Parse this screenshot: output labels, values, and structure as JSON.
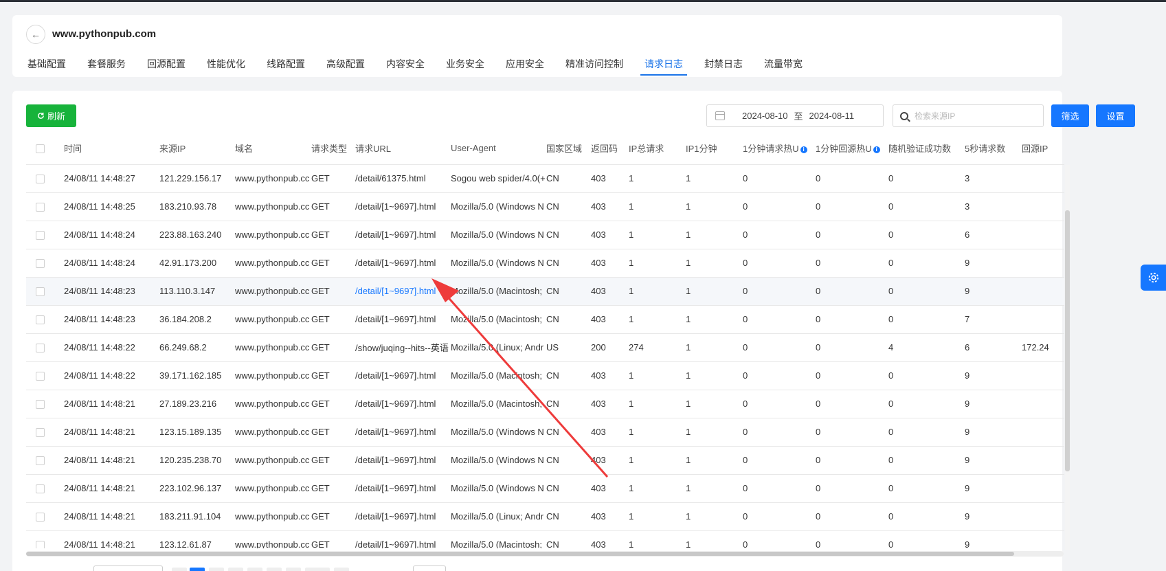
{
  "site": {
    "title": "www.pythonpub.com"
  },
  "tabs": [
    {
      "label": "基础配置"
    },
    {
      "label": "套餐服务"
    },
    {
      "label": "回源配置"
    },
    {
      "label": "性能优化"
    },
    {
      "label": "线路配置"
    },
    {
      "label": "高级配置"
    },
    {
      "label": "内容安全"
    },
    {
      "label": "业务安全"
    },
    {
      "label": "应用安全"
    },
    {
      "label": "精准访问控制"
    },
    {
      "label": "请求日志"
    },
    {
      "label": "封禁日志"
    },
    {
      "label": "流量带宽"
    }
  ],
  "active_tab": "请求日志",
  "toolbar": {
    "refresh_label": "刷新",
    "date_start": "2024-08-10",
    "date_sep": "至",
    "date_end": "2024-08-11",
    "search_placeholder": "检索来源IP",
    "filter_label": "筛选",
    "settings_label": "设置"
  },
  "table": {
    "headers": {
      "time": "时间",
      "src_ip": "来源IP",
      "domain": "域名",
      "method": "请求类型",
      "url": "请求URL",
      "ua": "User-Agent",
      "region": "国家区域",
      "code": "返回码",
      "ip_total": "IP总请求",
      "ip_1min": "IP1分钟",
      "hot_url": "1分钟请求热U",
      "hot_origin": "1分钟回源热U",
      "captcha": "随机验证成功数",
      "req5s": "5秒请求数",
      "origin_ip": "回源IP"
    },
    "rows": [
      {
        "time": "24/08/11 14:48:27",
        "ip": "121.229.156.17",
        "domain": "www.pythonpub.cc",
        "method": "GET",
        "url": "/detail/61375.html",
        "ua": "Sogou web spider/4.0(+",
        "region": "CN",
        "code": "403",
        "total": "1",
        "m1": "1",
        "hu": "0",
        "ho": "0",
        "cap": "0",
        "r5": "3",
        "oip": ""
      },
      {
        "time": "24/08/11 14:48:25",
        "ip": "183.210.93.78",
        "domain": "www.pythonpub.cc",
        "method": "GET",
        "url": "/detail/[1~9697].html",
        "ua": "Mozilla/5.0 (Windows N",
        "region": "CN",
        "code": "403",
        "total": "1",
        "m1": "1",
        "hu": "0",
        "ho": "0",
        "cap": "0",
        "r5": "3",
        "oip": ""
      },
      {
        "time": "24/08/11 14:48:24",
        "ip": "223.88.163.240",
        "domain": "www.pythonpub.cc",
        "method": "GET",
        "url": "/detail/[1~9697].html",
        "ua": "Mozilla/5.0 (Windows N",
        "region": "CN",
        "code": "403",
        "total": "1",
        "m1": "1",
        "hu": "0",
        "ho": "0",
        "cap": "0",
        "r5": "6",
        "oip": ""
      },
      {
        "time": "24/08/11 14:48:24",
        "ip": "42.91.173.200",
        "domain": "www.pythonpub.cc",
        "method": "GET",
        "url": "/detail/[1~9697].html",
        "ua": "Mozilla/5.0 (Windows N",
        "region": "CN",
        "code": "403",
        "total": "1",
        "m1": "1",
        "hu": "0",
        "ho": "0",
        "cap": "0",
        "r5": "9",
        "oip": ""
      },
      {
        "time": "24/08/11 14:48:23",
        "ip": "113.110.3.147",
        "domain": "www.pythonpub.cc",
        "method": "GET",
        "url": "/detail/[1~9697].html",
        "ua": "Mozilla/5.0 (Macintosh;",
        "region": "CN",
        "code": "403",
        "total": "1",
        "m1": "1",
        "hu": "0",
        "ho": "0",
        "cap": "0",
        "r5": "9",
        "oip": "",
        "hover": true
      },
      {
        "time": "24/08/11 14:48:23",
        "ip": "36.184.208.2",
        "domain": "www.pythonpub.cc",
        "method": "GET",
        "url": "/detail/[1~9697].html",
        "ua": "Mozilla/5.0 (Macintosh;",
        "region": "CN",
        "code": "403",
        "total": "1",
        "m1": "1",
        "hu": "0",
        "ho": "0",
        "cap": "0",
        "r5": "7",
        "oip": ""
      },
      {
        "time": "24/08/11 14:48:22",
        "ip": "66.249.68.2",
        "domain": "www.pythonpub.cc",
        "method": "GET",
        "url": "/show/juqing--hits--英语",
        "ua": "Mozilla/5.0 (Linux; Andr",
        "region": "US",
        "code": "200",
        "total": "274",
        "m1": "1",
        "hu": "0",
        "ho": "0",
        "cap": "4",
        "r5": "6",
        "oip": "172.24"
      },
      {
        "time": "24/08/11 14:48:22",
        "ip": "39.171.162.185",
        "domain": "www.pythonpub.cc",
        "method": "GET",
        "url": "/detail/[1~9697].html",
        "ua": "Mozilla/5.0 (Macintosh;",
        "region": "CN",
        "code": "403",
        "total": "1",
        "m1": "1",
        "hu": "0",
        "ho": "0",
        "cap": "0",
        "r5": "9",
        "oip": ""
      },
      {
        "time": "24/08/11 14:48:21",
        "ip": "27.189.23.216",
        "domain": "www.pythonpub.cc",
        "method": "GET",
        "url": "/detail/[1~9697].html",
        "ua": "Mozilla/5.0 (Macintosh;",
        "region": "CN",
        "code": "403",
        "total": "1",
        "m1": "1",
        "hu": "0",
        "ho": "0",
        "cap": "0",
        "r5": "9",
        "oip": ""
      },
      {
        "time": "24/08/11 14:48:21",
        "ip": "123.15.189.135",
        "domain": "www.pythonpub.cc",
        "method": "GET",
        "url": "/detail/[1~9697].html",
        "ua": "Mozilla/5.0 (Windows N",
        "region": "CN",
        "code": "403",
        "total": "1",
        "m1": "1",
        "hu": "0",
        "ho": "0",
        "cap": "0",
        "r5": "9",
        "oip": ""
      },
      {
        "time": "24/08/11 14:48:21",
        "ip": "120.235.238.70",
        "domain": "www.pythonpub.cc",
        "method": "GET",
        "url": "/detail/[1~9697].html",
        "ua": "Mozilla/5.0 (Windows N",
        "region": "CN",
        "code": "403",
        "total": "1",
        "m1": "1",
        "hu": "0",
        "ho": "0",
        "cap": "0",
        "r5": "9",
        "oip": ""
      },
      {
        "time": "24/08/11 14:48:21",
        "ip": "223.102.96.137",
        "domain": "www.pythonpub.cc",
        "method": "GET",
        "url": "/detail/[1~9697].html",
        "ua": "Mozilla/5.0 (Windows N",
        "region": "CN",
        "code": "403",
        "total": "1",
        "m1": "1",
        "hu": "0",
        "ho": "0",
        "cap": "0",
        "r5": "9",
        "oip": ""
      },
      {
        "time": "24/08/11 14:48:21",
        "ip": "183.211.91.104",
        "domain": "www.pythonpub.cc",
        "method": "GET",
        "url": "/detail/[1~9697].html",
        "ua": "Mozilla/5.0 (Linux; Andr",
        "region": "CN",
        "code": "403",
        "total": "1",
        "m1": "1",
        "hu": "0",
        "ho": "0",
        "cap": "0",
        "r5": "9",
        "oip": ""
      },
      {
        "time": "24/08/11 14:48:21",
        "ip": "123.12.61.87",
        "domain": "www.pythonpub.cc",
        "method": "GET",
        "url": "/detail/[1~9697].html",
        "ua": "Mozilla/5.0 (Macintosh;",
        "region": "CN",
        "code": "403",
        "total": "1",
        "m1": "1",
        "hu": "0",
        "ho": "0",
        "cap": "0",
        "r5": "9",
        "oip": ""
      }
    ]
  },
  "colors": {
    "accent": "#1677ff",
    "refresh": "#17b33b",
    "annotation_arrow": "#ee3b3b"
  },
  "icons": {
    "back": "arrow-left-icon",
    "refresh": "refresh-icon",
    "calendar": "calendar-icon",
    "search": "search-icon",
    "info": "info-icon",
    "float": "gear-icon"
  }
}
